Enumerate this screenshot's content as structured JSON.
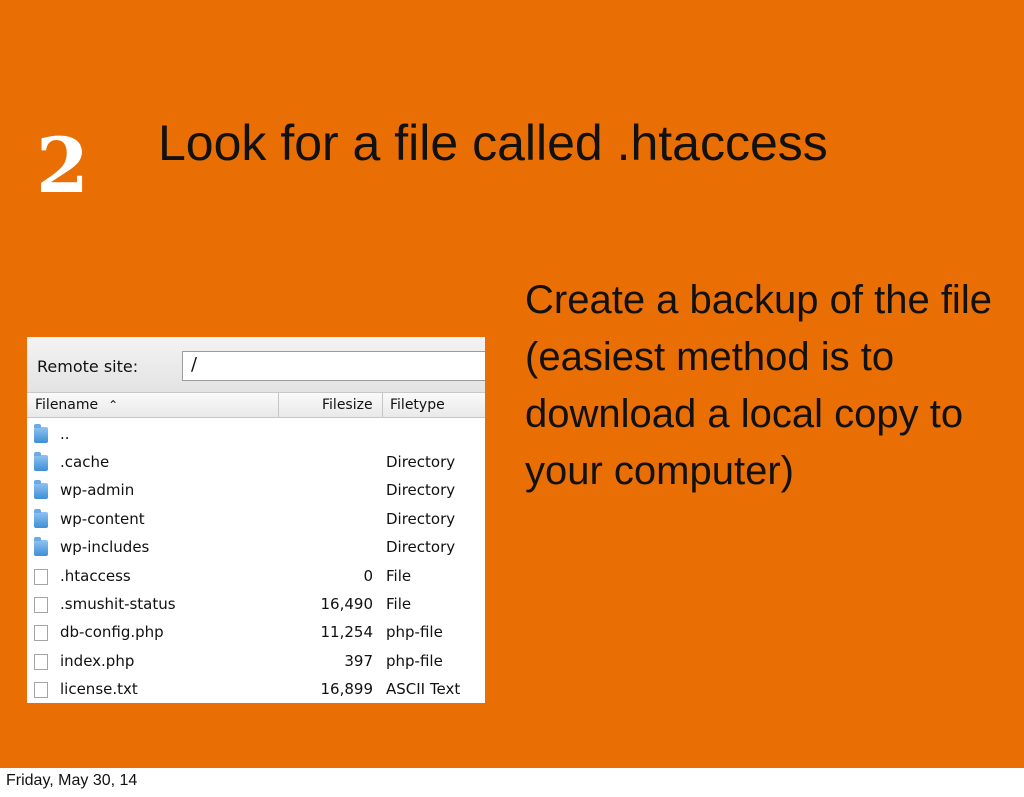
{
  "slide": {
    "step_number": "2",
    "title": "Look for a file called .htaccess",
    "instructions": "Create a backup of the file (easiest method is to download a local copy to your computer)",
    "footer_date": "Friday, May 30, 14",
    "background_color": "#e96e04"
  },
  "ftp_panel": {
    "remote_site_label": "Remote site:",
    "remote_site_value": "/",
    "columns": [
      "Filename",
      "Filesize",
      "Filetype"
    ],
    "sort_indicator_icon": "chevron-up-icon",
    "files": [
      {
        "name": "..",
        "size": "",
        "type": "",
        "icon": "folder-icon"
      },
      {
        "name": ".cache",
        "size": "",
        "type": "Directory",
        "icon": "folder-icon"
      },
      {
        "name": "wp-admin",
        "size": "",
        "type": "Directory",
        "icon": "folder-icon"
      },
      {
        "name": "wp-content",
        "size": "",
        "type": "Directory",
        "icon": "folder-icon"
      },
      {
        "name": "wp-includes",
        "size": "",
        "type": "Directory",
        "icon": "folder-icon"
      },
      {
        "name": ".htaccess",
        "size": "0",
        "type": "File",
        "icon": "file-icon"
      },
      {
        "name": ".smushit-status",
        "size": "16,490",
        "type": "File",
        "icon": "file-icon"
      },
      {
        "name": "db-config.php",
        "size": "11,254",
        "type": "php-file",
        "icon": "file-icon"
      },
      {
        "name": "index.php",
        "size": "397",
        "type": "php-file",
        "icon": "file-icon"
      },
      {
        "name": "license.txt",
        "size": "16,899",
        "type": "ASCII Text",
        "icon": "file-icon"
      }
    ]
  }
}
